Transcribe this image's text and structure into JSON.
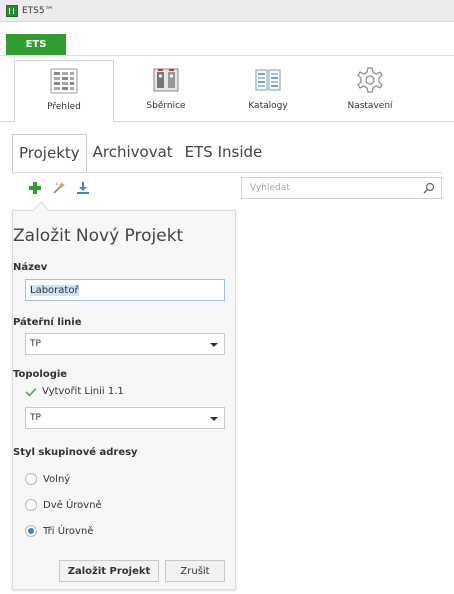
{
  "window": {
    "title": "ETS5™"
  },
  "app_tab": {
    "label": "ETS"
  },
  "ribbon": {
    "items": [
      {
        "label": "Přehled",
        "icon": "overview-icon"
      },
      {
        "label": "Sběrnice",
        "icon": "bus-icon"
      },
      {
        "label": "Katalogy",
        "icon": "catalog-icon"
      },
      {
        "label": "Nastavení",
        "icon": "settings-gear-icon"
      }
    ]
  },
  "tabs": [
    {
      "label": "Projekty"
    },
    {
      "label": "Archivovat"
    },
    {
      "label": "ETS Inside"
    }
  ],
  "toolbar": {
    "search_placeholder": "Vyhledat"
  },
  "new_project": {
    "title": "Založit Nový Projekt",
    "name_label": "Název",
    "name_value": "Laboratoř",
    "backbone_label": "Páteřní linie",
    "backbone_value": "TP",
    "topology_label": "Topologie",
    "create_line_label": "Vytvořit Linii 1.1",
    "topology_value": "TP",
    "group_address_label": "Styl skupinové adresy",
    "group_address_options": [
      {
        "label": "Volný",
        "checked": false
      },
      {
        "label": "Dvě Úrovně",
        "checked": false
      },
      {
        "label": "Tři Úrovně",
        "checked": true
      }
    ],
    "create_button": "Založit Projekt",
    "cancel_button": "Zrušit"
  },
  "colors": {
    "accent_green": "#2f9e2f",
    "radio_selected": "#4a7fc1"
  }
}
